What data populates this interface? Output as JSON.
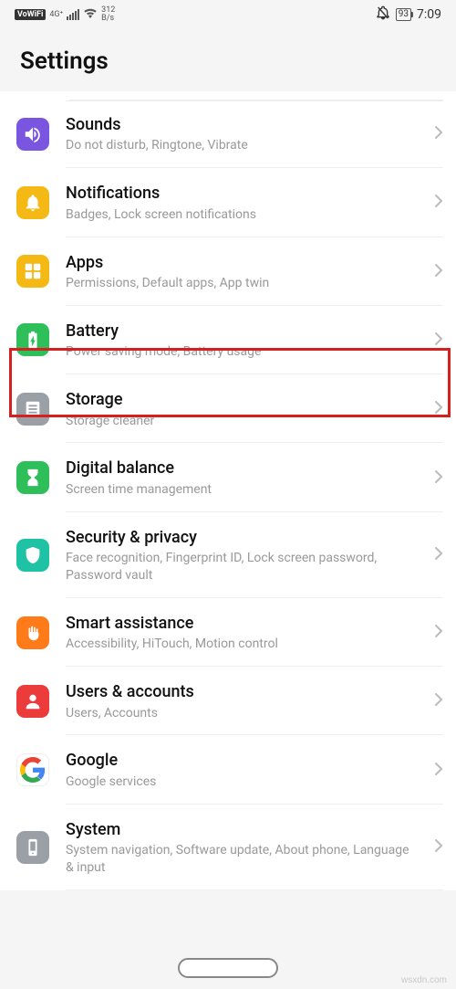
{
  "status": {
    "vowifi": "VoWiFi",
    "net": "4G⁺",
    "speed_top": "312",
    "speed_bottom": "B/s",
    "battery": "93",
    "time": "7:09"
  },
  "header": {
    "title": "Settings"
  },
  "items": [
    {
      "id": "sounds",
      "title": "Sounds",
      "sub": "Do not disturb, Ringtone, Vibrate",
      "color": "#7a55e0"
    },
    {
      "id": "notifications",
      "title": "Notifications",
      "sub": "Badges, Lock screen notifications",
      "color": "#f5b915"
    },
    {
      "id": "apps",
      "title": "Apps",
      "sub": "Permissions, Default apps, App twin",
      "color": "#f5b915",
      "highlight": true
    },
    {
      "id": "battery",
      "title": "Battery",
      "sub": "Power saving mode, Battery usage",
      "color": "#2fbf5a"
    },
    {
      "id": "storage",
      "title": "Storage",
      "sub": "Storage cleaner",
      "color": "#9aa0a6"
    },
    {
      "id": "digital-balance",
      "title": "Digital balance",
      "sub": "Screen time management",
      "color": "#2fbf5a"
    },
    {
      "id": "security",
      "title": "Security & privacy",
      "sub": "Face recognition, Fingerprint ID, Lock screen password, Password vault",
      "color": "#1fc2a5"
    },
    {
      "id": "smart-assistance",
      "title": "Smart assistance",
      "sub": "Accessibility, HiTouch, Motion control",
      "color": "#ff7b1a"
    },
    {
      "id": "users",
      "title": "Users & accounts",
      "sub": "Users, Accounts",
      "color": "#eb3b3b"
    },
    {
      "id": "google",
      "title": "Google",
      "sub": "Google services",
      "color": "#ffffff"
    },
    {
      "id": "system",
      "title": "System",
      "sub": "System navigation, Software update, About phone, Language & input",
      "color": "#9aa0a6"
    }
  ],
  "watermark": "wsxdn.com"
}
